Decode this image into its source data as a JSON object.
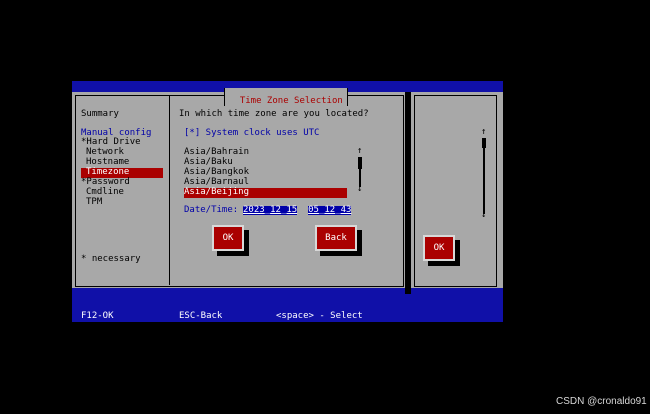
{
  "dialog": {
    "title": "Time Zone Selection"
  },
  "sidebar": {
    "summary": "Summary",
    "manual_config": "Manual config",
    "items": [
      {
        "label": "*Hard Drive",
        "selected": false
      },
      {
        "label": "Network",
        "selected": false
      },
      {
        "label": "Hostname",
        "selected": false
      },
      {
        "label": "Timezone",
        "selected": true
      },
      {
        "label": "*Password",
        "selected": false
      },
      {
        "label": "Cmdline",
        "selected": false
      },
      {
        "label": "TPM",
        "selected": false
      }
    ],
    "necessary_note": "* necessary"
  },
  "main": {
    "question": "In which time zone are you located?",
    "utc_checkbox_label": "[*] System clock uses UTC",
    "timezones": [
      {
        "label": "Asia/Bahrain",
        "selected": false
      },
      {
        "label": "Asia/Baku",
        "selected": false
      },
      {
        "label": "Asia/Bangkok",
        "selected": false
      },
      {
        "label": "Asia/Barnaul",
        "selected": false
      },
      {
        "label": "Asia/Beijing",
        "selected": true
      }
    ],
    "datetime_label": "Date/Time:",
    "date": {
      "year": "2023",
      "month": "12",
      "day": "15"
    },
    "time": {
      "hour": "05",
      "minute": "12",
      "second": "43"
    },
    "ok_label": "OK",
    "back_label": "Back"
  },
  "right_panel": {
    "ok_label": "OK"
  },
  "footer": {
    "f12": "F12-OK",
    "esc": "ESC-Back",
    "space": "<space> - Select"
  },
  "watermark": "CSDN @cronaldo91",
  "colors": {
    "background": "#000000",
    "blue": "#1010a8",
    "grey": "#a8a8a8",
    "red": "#aa0000",
    "navy_text": "#0000a8"
  }
}
